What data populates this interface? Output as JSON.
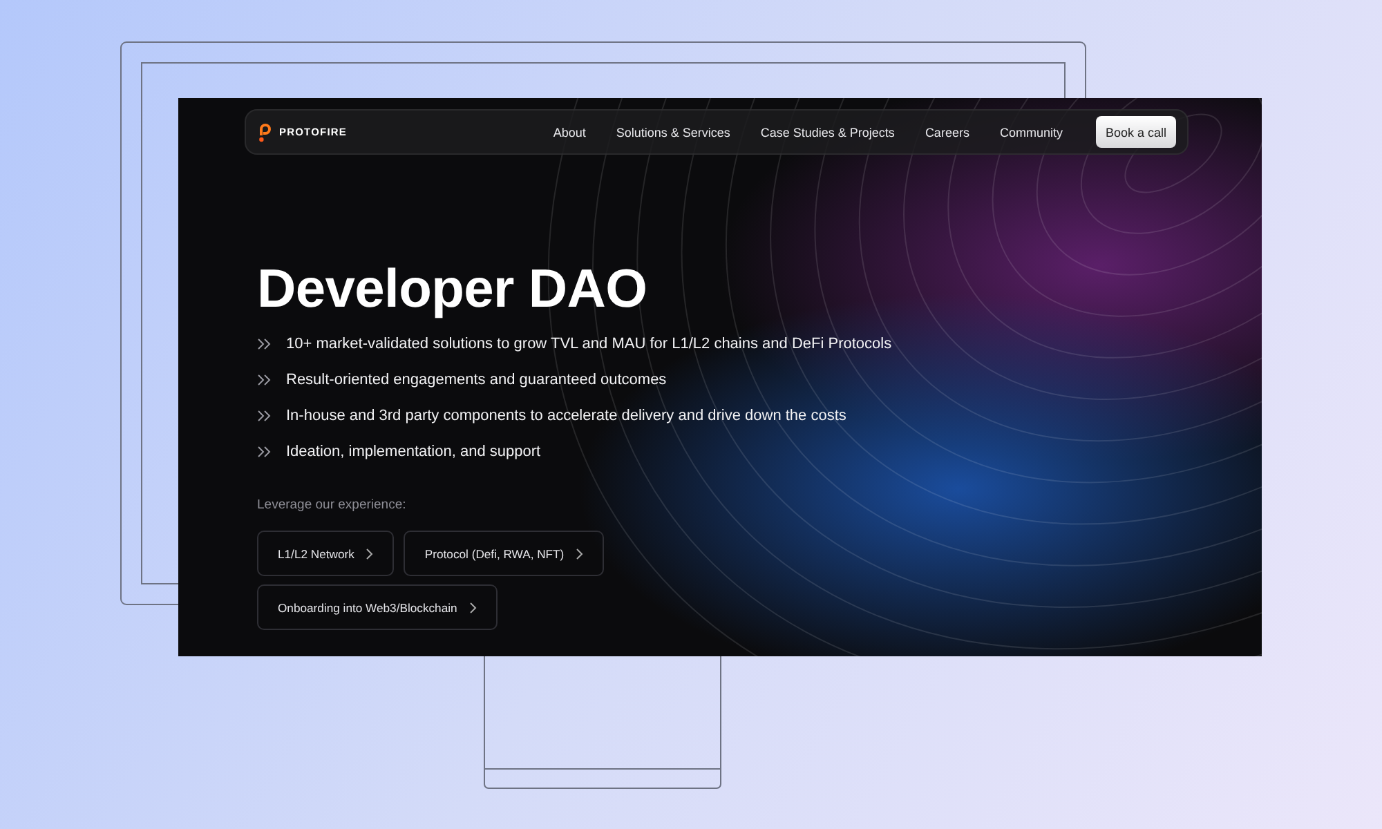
{
  "brand": {
    "name": "PROTOFIRE"
  },
  "nav": {
    "links": [
      "About",
      "Solutions & Services",
      "Case Studies & Projects",
      "Careers",
      "Community"
    ],
    "cta": "Book a call"
  },
  "hero": {
    "title": "Developer DAO",
    "points": [
      "10+ market-validated solutions to grow TVL and MAU for L1/L2 chains and DeFi Protocols",
      "Result-oriented engagements and guaranteed outcomes",
      "In-house and 3rd party components to accelerate delivery and drive down the costs",
      "Ideation, implementation, and support"
    ],
    "prompt": "Leverage our experience:",
    "options": [
      "L1/L2 Network",
      "Protocol (Defi, RWA, NFT)",
      "Onboarding into Web3/Blockchain"
    ]
  }
}
